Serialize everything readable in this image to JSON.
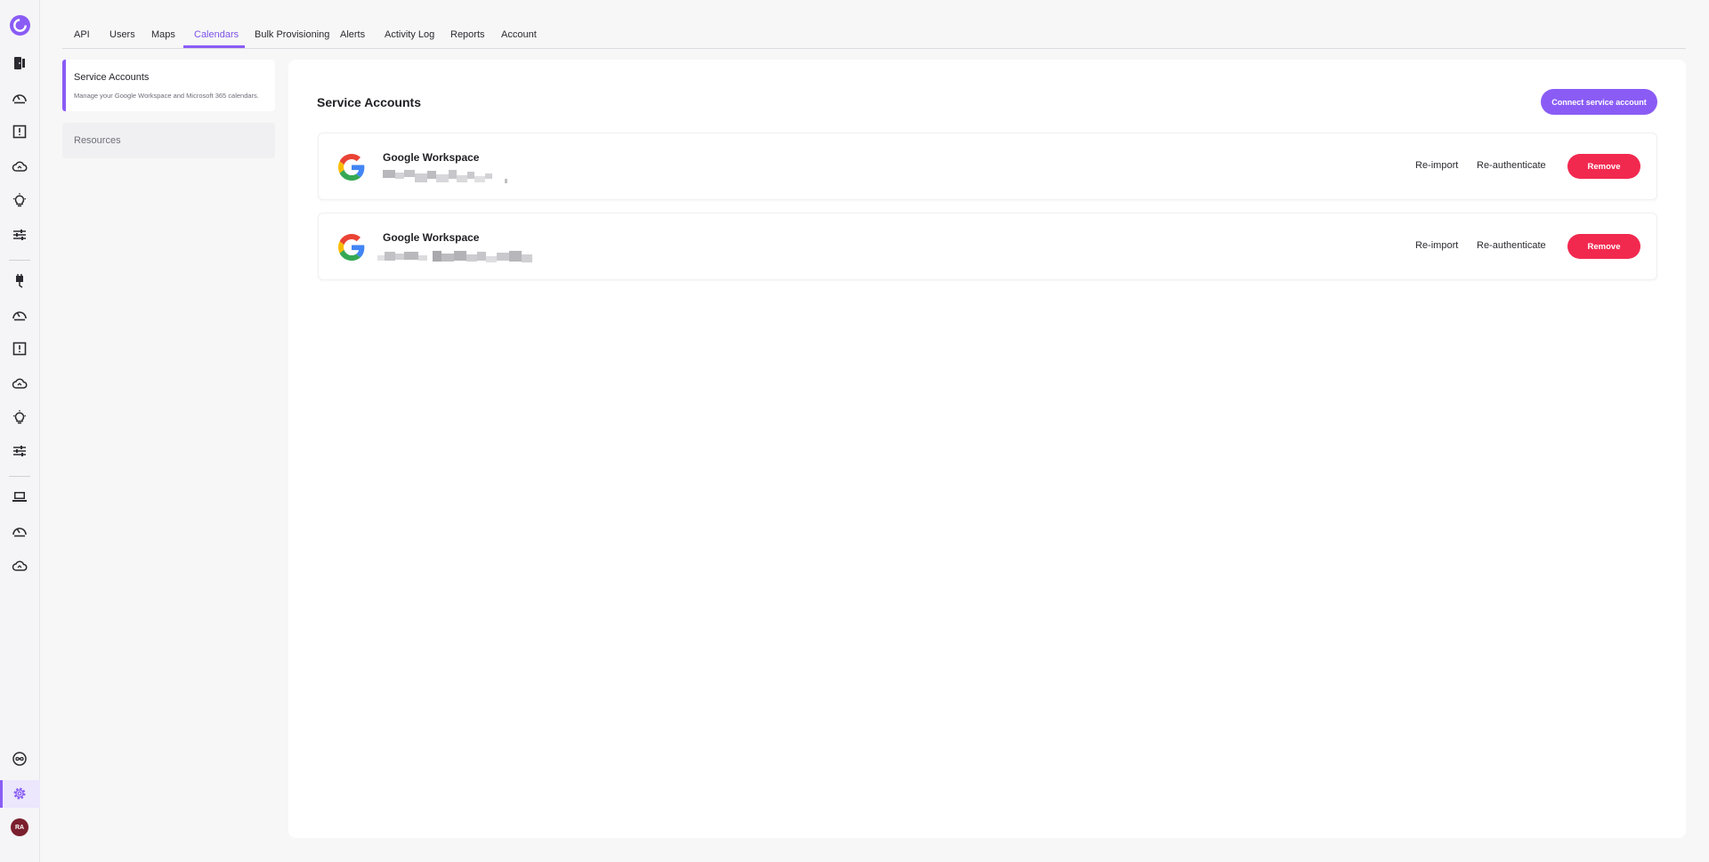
{
  "brand": {
    "accent": "#8a5cf5",
    "danger": "#f2294f"
  },
  "sidebar": {
    "icons": [
      "app-logo-icon",
      "door-icon",
      "gauge-icon",
      "alert-panel-icon",
      "cloud-icon",
      "lightbulb-icon",
      "sliders-icon",
      "plug-icon",
      "gauge-icon",
      "alert-panel-icon",
      "cloud-icon",
      "lightbulb-icon",
      "sliders-icon",
      "laptop-icon",
      "gauge-icon",
      "cloud-icon",
      "infinity-icon",
      "gear-icon"
    ],
    "avatar_initials": "RA",
    "active": "settings"
  },
  "tabs": [
    {
      "label": "API"
    },
    {
      "label": "Users"
    },
    {
      "label": "Maps"
    },
    {
      "label": "Calendars",
      "active": true
    },
    {
      "label": "Bulk Provisioning"
    },
    {
      "label": "Alerts"
    },
    {
      "label": "Activity Log"
    },
    {
      "label": "Reports"
    },
    {
      "label": "Account"
    }
  ],
  "subnav": {
    "service_accounts": {
      "title": "Service Accounts",
      "description": "Manage your Google Workspace and Microsoft 365 calendars."
    },
    "resources": {
      "title": "Resources"
    }
  },
  "main": {
    "title": "Service Accounts",
    "connect_label": "Connect service account",
    "accounts": [
      {
        "provider": "Google Workspace",
        "email_redacted": true,
        "reimport_label": "Re-import",
        "reauth_label": "Re-authenticate",
        "remove_label": "Remove"
      },
      {
        "provider": "Google Workspace",
        "email_redacted": true,
        "reimport_label": "Re-import",
        "reauth_label": "Re-authenticate",
        "remove_label": "Remove"
      }
    ]
  }
}
